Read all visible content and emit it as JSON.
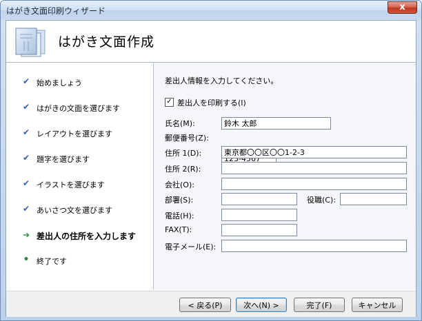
{
  "window": {
    "title": "はがき文面印刷ウィザード",
    "close_glyph": "x"
  },
  "header": {
    "title": "はがき文面作成",
    "icon": "wizard-postcard-icon"
  },
  "steps": [
    {
      "label": "始めましょう",
      "state": "done"
    },
    {
      "label": "はがきの文面を選びます",
      "state": "done"
    },
    {
      "label": "レイアウトを選びます",
      "state": "done"
    },
    {
      "label": "題字を選びます",
      "state": "done"
    },
    {
      "label": "イラストを選びます",
      "state": "done"
    },
    {
      "label": "あいさつ文を選びます",
      "state": "done"
    },
    {
      "label": "差出人の住所を入力します",
      "state": "current"
    },
    {
      "label": "終了です",
      "state": "pending"
    }
  ],
  "form": {
    "instruction": "差出人情報を入力してください。",
    "print_sender_label": "差出人を印刷する(I)",
    "print_sender_checked": true,
    "fields": {
      "name": {
        "label": "氏名(M):",
        "value": "鈴木 太郎"
      },
      "postal": {
        "label": "郵便番号(Z):",
        "value": "123-4567"
      },
      "address1": {
        "label": "住所 1(D):",
        "value": "東京都〇〇区〇〇1-2-3"
      },
      "address2": {
        "label": "住所 2(R):",
        "value": ""
      },
      "company": {
        "label": "会社(O):",
        "value": ""
      },
      "department": {
        "label": "部署(S):",
        "value": ""
      },
      "title": {
        "label": "役職(C):",
        "value": ""
      },
      "phone": {
        "label": "電話(H):",
        "value": ""
      },
      "fax": {
        "label": "FAX(T):",
        "value": ""
      },
      "email": {
        "label": "電子メール(E):",
        "value": ""
      }
    }
  },
  "buttons": {
    "back": "< 戻る(P)",
    "next": "次へ(N) >",
    "finish": "完了(F)",
    "cancel": "キャンセル"
  }
}
